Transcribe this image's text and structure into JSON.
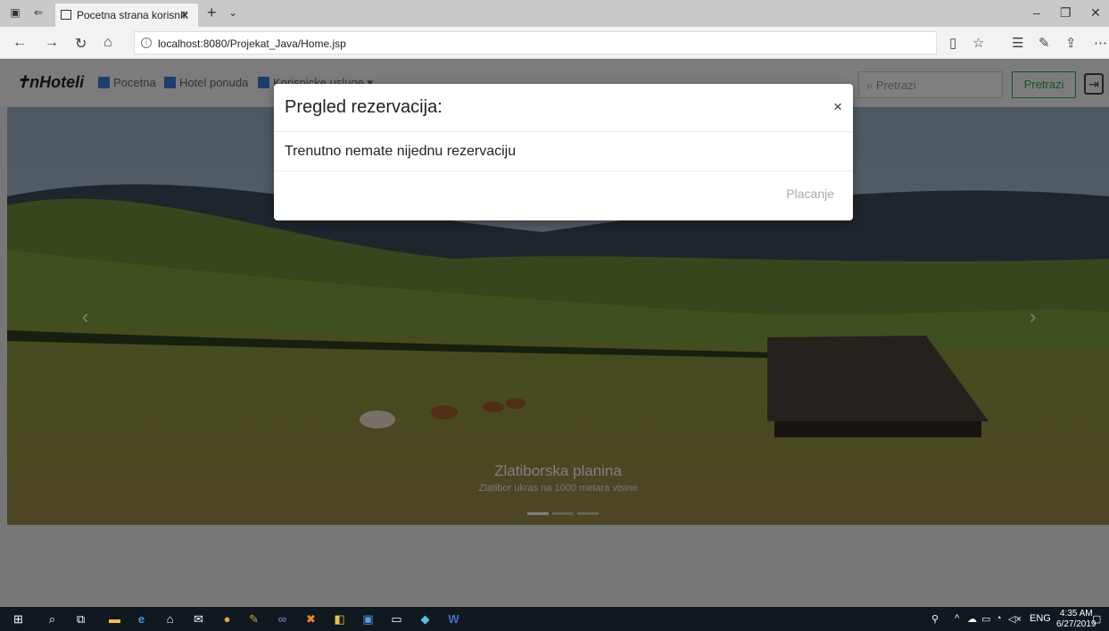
{
  "browser": {
    "tab_title": "Pocetna strana korisnik",
    "url": "localhost:8080/Projekat_Java/Home.jsp"
  },
  "site": {
    "brand": "nHoteli",
    "nav": [
      {
        "label": "Pocetna"
      },
      {
        "label": "Hotel ponuda"
      },
      {
        "label": "Korisnicke usluge ▾"
      }
    ],
    "search_placeholder": "Pretrazi",
    "search_button": "Pretrazi"
  },
  "hero": {
    "title": "Zlatiborska planina",
    "subtitle": "Zlatibor ukras na 1000 metara visine",
    "slide_count": 3,
    "active_slide": 1
  },
  "modal": {
    "title": "Pregled rezervacija:",
    "close": "×",
    "message": "Trenutno nemate nijednu rezervaciju",
    "pay_button": "Placanje"
  },
  "taskbar": {
    "language": "ENG",
    "time": "4:35 AM",
    "date": "6/27/2019"
  }
}
